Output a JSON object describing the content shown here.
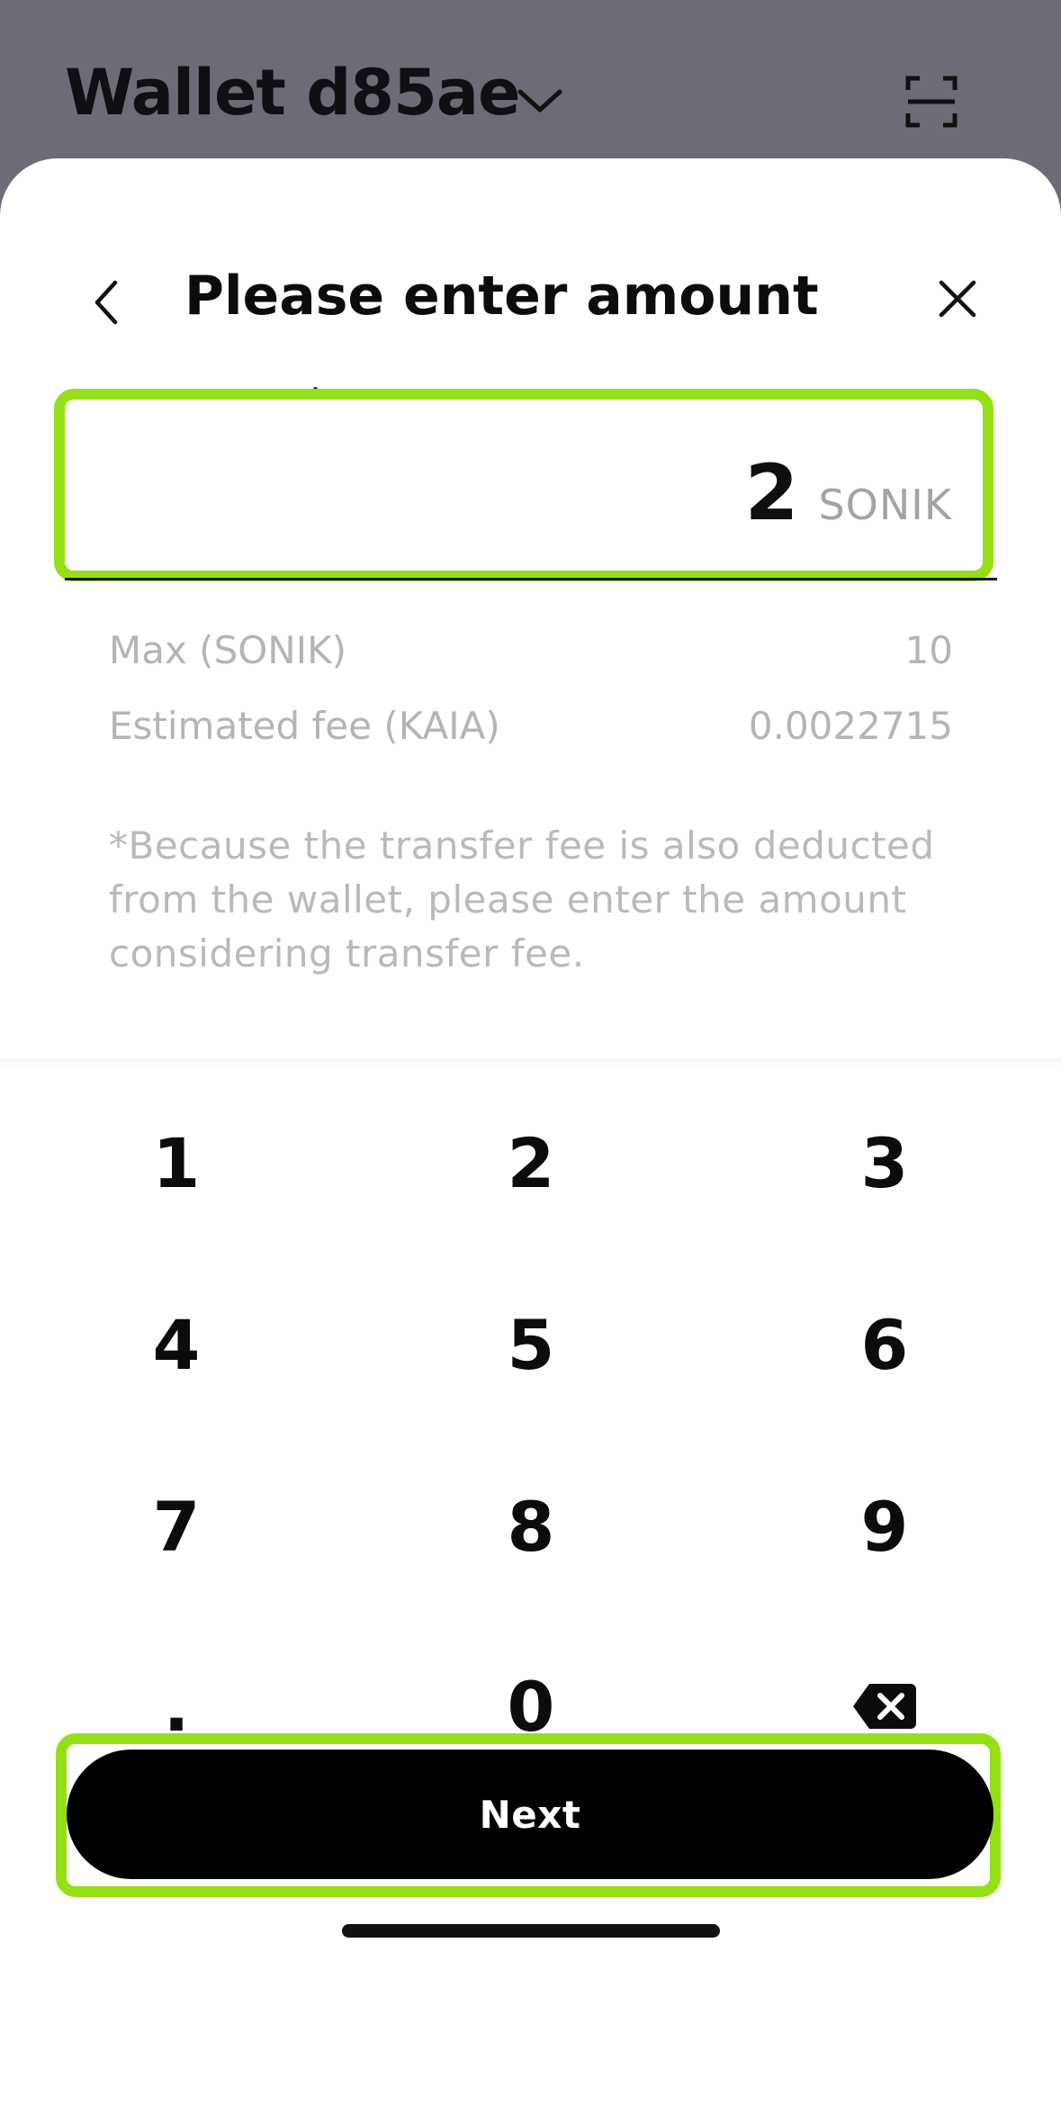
{
  "wallet": {
    "title": "Wallet d85ae"
  },
  "sheet": {
    "title": "Please enter amount"
  },
  "amount": {
    "value": "2",
    "unit": "SONIK"
  },
  "info": {
    "max_label": "Max (SONIK)",
    "max_value": "10",
    "fee_label": "Estimated fee (KAIA)",
    "fee_value": "0.0022715"
  },
  "notice": "*Because the transfer fee is also deducted from the wallet, please enter the amount considering transfer fee.",
  "keypad": {
    "k1": "1",
    "k2": "2",
    "k3": "3",
    "k4": "4",
    "k5": "5",
    "k6": "6",
    "k7": "7",
    "k8": "8",
    "k9": "9",
    "dot": ".",
    "k0": "0"
  },
  "next_button": "Next",
  "colors": {
    "highlight": "#94e015",
    "background_dim": "#6e6a76"
  }
}
